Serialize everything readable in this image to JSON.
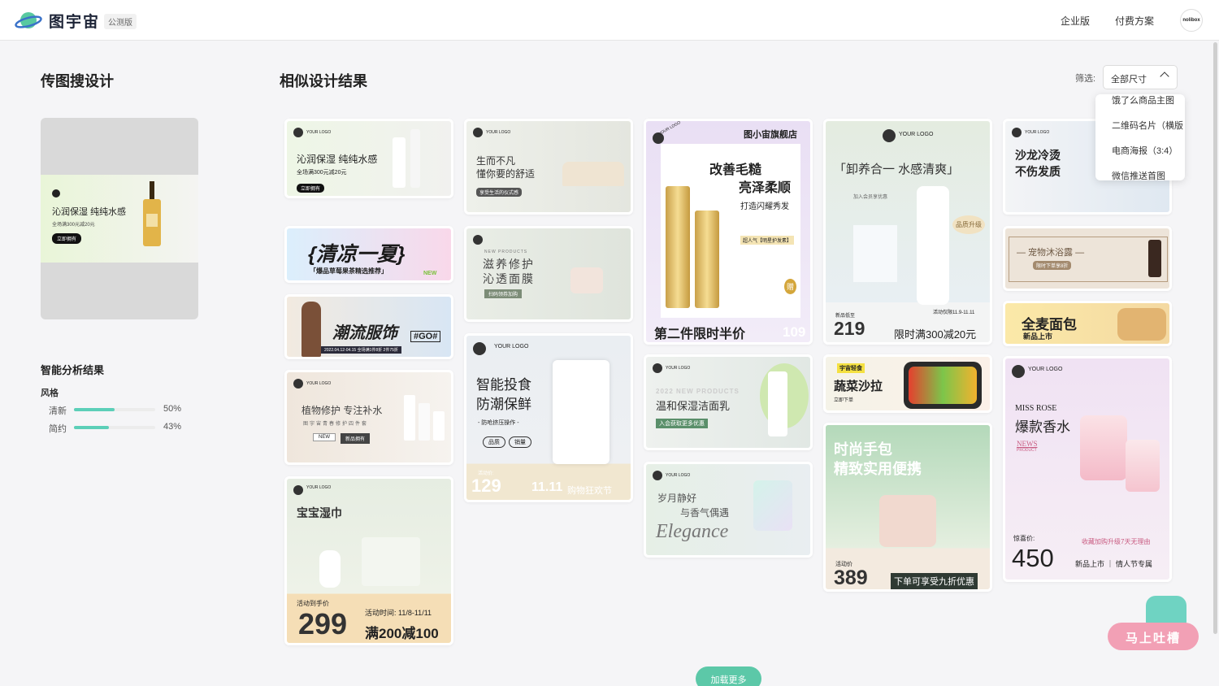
{
  "header": {
    "brand": "图宇宙",
    "edition": "公测版",
    "nav": [
      {
        "label": "企业版"
      },
      {
        "label": "付费方案"
      }
    ],
    "avatar_text": "nolibox"
  },
  "left": {
    "title": "传图搜设计",
    "upload_preview": {
      "headline": "沁润保湿 纯纯水感",
      "subline": "全场满300元减20元",
      "button": "立即拥有"
    },
    "analysis_title": "智能分析结果",
    "style_label": "风格",
    "styles": [
      {
        "name": "清新",
        "value": 50,
        "label": "50%"
      },
      {
        "name": "简约",
        "value": 43,
        "label": "43%"
      }
    ]
  },
  "right": {
    "title": "相似设计结果",
    "filter_label": "筛选:",
    "filter_value": "全部尺寸",
    "dropdown_options": [
      "饿了么商品主图",
      "二维码名片（横版",
      "电商海报（3:4）",
      "微信推送首图"
    ]
  },
  "cards": [
    {
      "texts": [
        "YOUR LOGO",
        "沁润保湿 纯纯水感",
        "全场满300元减20元",
        "立即拥有"
      ]
    },
    {
      "texts": [
        "{清凉一夏}",
        "「爆品草莓果茶精选推荐」",
        "NEW"
      ]
    },
    {
      "texts": [
        "潮流服饰",
        "#GO#",
        "2022.04.12-04.15 全场满1件8折 2件75折"
      ]
    },
    {
      "texts": [
        "YOUR LOGO",
        "植物修护 专注补水",
        "图宇宙青春修护四件套",
        "NEW",
        "新品拥有"
      ]
    },
    {
      "texts": [
        "YOUR LOGO",
        "宝宝湿巾",
        "活动到手价",
        "299",
        "活动时间: 11/8-11/11",
        "满200减100"
      ]
    },
    {
      "texts": [
        "YOUR LOGO",
        "生而不凡",
        "懂你要的舒适",
        "享受生活的仪式感"
      ]
    },
    {
      "texts": [
        "NEW PRODUCTS",
        "滋养修护",
        "沁透面膜",
        "扫码领券加购"
      ]
    },
    {
      "texts": [
        "YOUR LOGO",
        "智能投食",
        "防潮保鲜",
        "- 防呛挤压操作 -",
        "品质",
        "销量",
        "活动价:",
        "129",
        "11.11",
        "购物狂欢节"
      ]
    },
    {
      "texts": [
        "YOUR LOGO",
        "图小宙旗舰店",
        "改善毛糙",
        "亮泽柔顺",
        "打造闪耀秀发",
        "超人气【明星护发素】",
        "赠",
        "第二件限时半价",
        "109"
      ]
    },
    {
      "texts": [
        "YOUR LOGO",
        "2022 NEW PRODUCTS",
        "温和保湿洁面乳",
        "入会获取更多优惠"
      ]
    },
    {
      "texts": [
        "YOUR LOGO",
        "岁月静好",
        "与香气偶遇",
        "Elegance"
      ]
    },
    {
      "texts": [
        "YOUR LOGO",
        "「卸养合一 水感清爽」",
        "加入会员享优惠",
        "品质升级",
        "新品低至",
        "219",
        "活动仅限11.9-11.11",
        "限时满300减20元"
      ]
    },
    {
      "texts": [
        "宇宙轻食",
        "蔬菜沙拉",
        "立即下单"
      ]
    },
    {
      "texts": [
        "时尚手包",
        "精致实用便携",
        "活动价",
        "389",
        "下单可享受九折优惠"
      ]
    },
    {
      "texts": [
        "YOUR LOGO",
        "沙龙冷烫",
        "不伤发质"
      ]
    },
    {
      "texts": [
        "— 宠物沐浴露 —",
        "限时下单享8折"
      ]
    },
    {
      "texts": [
        "全麦面包",
        "新品上市"
      ]
    },
    {
      "texts": [
        "YOUR LOGO",
        "MISS ROSE",
        "爆款香水",
        "NEWS",
        "PRODUCT",
        "惊喜价:",
        "450",
        "收藏加购升级7天无理由",
        "新品上市 ｜ 情人节专属"
      ]
    }
  ],
  "load_more": "加载更多",
  "feedback": "马上吐槽"
}
